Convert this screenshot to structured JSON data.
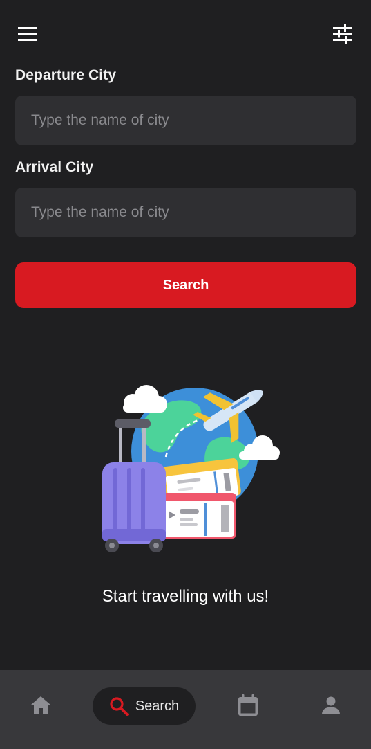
{
  "header": {
    "menu_icon": "menu-icon",
    "filter_icon": "tune-icon"
  },
  "form": {
    "departure_label": "Departure City",
    "departure_placeholder": "Type the name of city",
    "departure_value": "",
    "arrival_label": "Arrival City",
    "arrival_placeholder": "Type the name of city",
    "arrival_value": "",
    "search_label": "Search"
  },
  "illustration": {
    "icon": "travel-illustration"
  },
  "tagline": "Start travelling with us!",
  "bottom_nav": {
    "items": [
      {
        "name": "home",
        "icon": "home-icon",
        "label": "",
        "active": false
      },
      {
        "name": "search",
        "icon": "search-icon",
        "label": "Search",
        "active": true
      },
      {
        "name": "calendar",
        "icon": "calendar-icon",
        "label": "",
        "active": false
      },
      {
        "name": "profile",
        "icon": "person-icon",
        "label": "",
        "active": false
      }
    ]
  },
  "colors": {
    "background": "#1f1f21",
    "field": "#2f2f32",
    "accent": "#d81a21",
    "nav_background": "#38383b",
    "nav_icon": "#8e8e93"
  }
}
